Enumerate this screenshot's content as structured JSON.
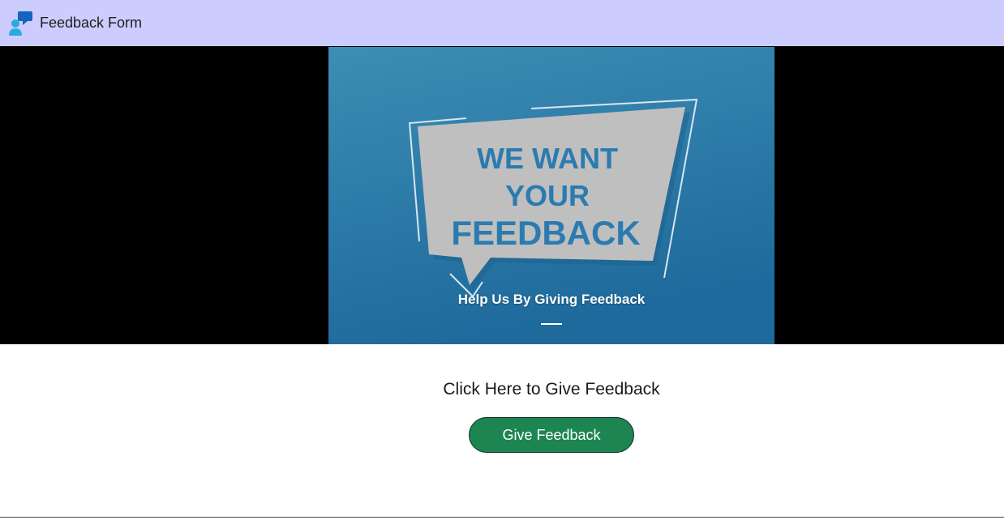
{
  "app": {
    "title": "Feedback Form",
    "logo_icon": "chat-user-icon"
  },
  "banner": {
    "headline_line1": "WE WANT",
    "headline_line2": "YOUR",
    "headline_line3": "FEEDBACK",
    "caption": "Help Us By Giving Feedback"
  },
  "cta": {
    "heading": "Click Here to Give Feedback",
    "button_label": "Give Feedback"
  },
  "colors": {
    "topbar": "#ccccff",
    "banner_blue": "#2a7fb0",
    "button_green": "#1c8552"
  }
}
